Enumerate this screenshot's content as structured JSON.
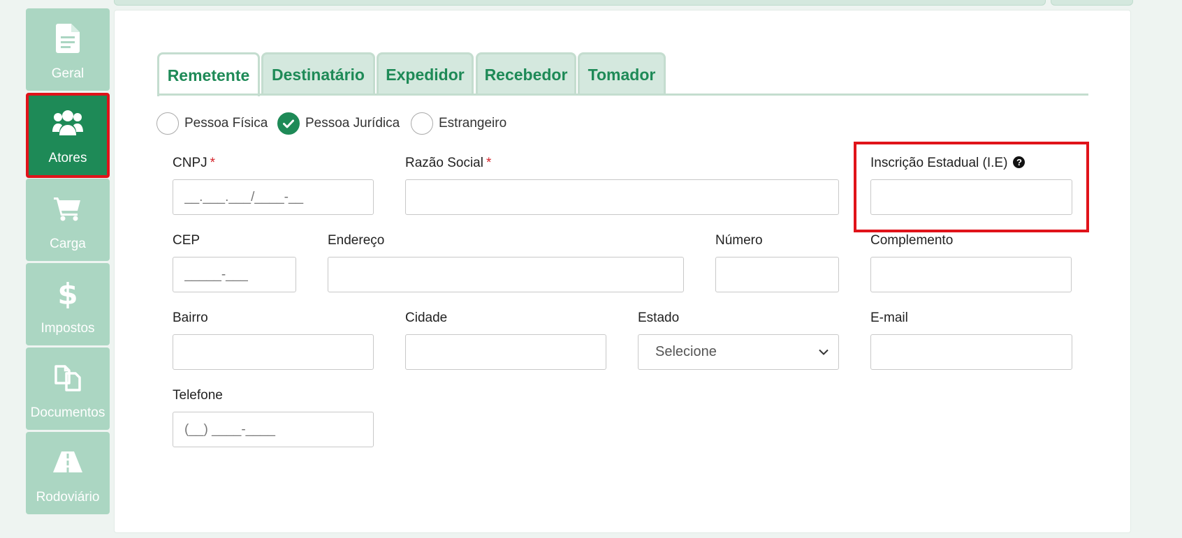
{
  "sidebar": {
    "items": [
      {
        "label": "Geral",
        "icon": "document-icon"
      },
      {
        "label": "Atores",
        "icon": "users-icon",
        "active": true
      },
      {
        "label": "Carga",
        "icon": "cart-icon"
      },
      {
        "label": "Impostos",
        "icon": "dollar-icon"
      },
      {
        "label": "Documentos",
        "icon": "copy-documents-icon"
      },
      {
        "label": "Rodoviário",
        "icon": "road-icon"
      }
    ]
  },
  "tabs": [
    {
      "label": "Remetente",
      "active": true
    },
    {
      "label": "Destinatário"
    },
    {
      "label": "Expedidor"
    },
    {
      "label": "Recebedor"
    },
    {
      "label": "Tomador"
    }
  ],
  "person_type": {
    "options": [
      "Pessoa Física",
      "Pessoa Jurídica",
      "Estrangeiro"
    ],
    "selected": "Pessoa Jurídica"
  },
  "form": {
    "cnpj": {
      "label": "CNPJ",
      "required": "*",
      "placeholder": "__.___.___/____-__"
    },
    "razao_social": {
      "label": "Razão Social",
      "required": "*",
      "placeholder": ""
    },
    "inscricao_estadual": {
      "label": "Inscrição Estadual (I.E)",
      "help": "?",
      "placeholder": ""
    },
    "cep": {
      "label": "CEP",
      "placeholder": "_____-___"
    },
    "endereco": {
      "label": "Endereço",
      "placeholder": ""
    },
    "numero": {
      "label": "Número",
      "placeholder": ""
    },
    "complemento": {
      "label": "Complemento",
      "placeholder": ""
    },
    "bairro": {
      "label": "Bairro",
      "placeholder": ""
    },
    "cidade": {
      "label": "Cidade",
      "placeholder": ""
    },
    "estado": {
      "label": "Estado",
      "selected": "Selecione"
    },
    "email": {
      "label": "E-mail",
      "placeholder": ""
    },
    "telefone": {
      "label": "Telefone",
      "placeholder": "(__) ____-____"
    }
  },
  "colors": {
    "accent": "#1e8a57",
    "highlight": "#e0131a",
    "sidebar_bg": "#abd6c2",
    "tab_bg": "#d4e8de"
  }
}
